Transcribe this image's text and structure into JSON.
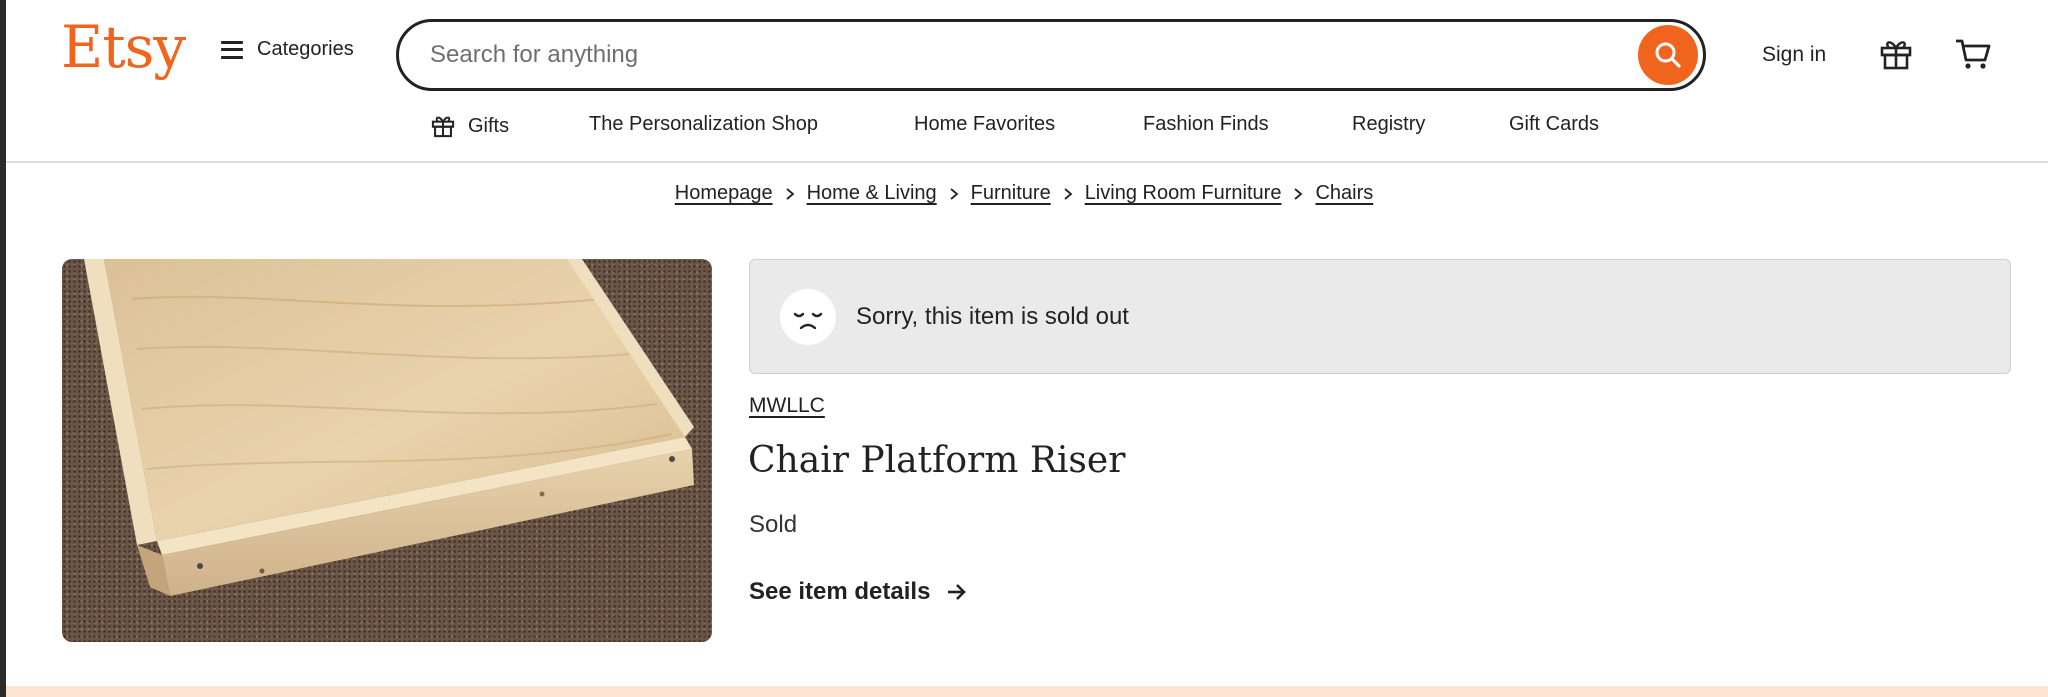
{
  "header": {
    "logo": "Etsy",
    "categories_label": "Categories",
    "search_placeholder": "Search for anything",
    "signin_label": "Sign in"
  },
  "nav": {
    "items": [
      {
        "label": "Gifts",
        "icon": "gift-icon"
      },
      {
        "label": "The Personalization Shop"
      },
      {
        "label": "Home Favorites"
      },
      {
        "label": "Fashion Finds"
      },
      {
        "label": "Registry"
      },
      {
        "label": "Gift Cards"
      }
    ]
  },
  "breadcrumb": [
    "Homepage",
    "Home & Living",
    "Furniture",
    "Living Room Furniture",
    "Chairs"
  ],
  "listing": {
    "sold_out_message": "Sorry, this item is sold out",
    "shop_name": "MWLLC",
    "title": "Chair Platform Riser",
    "status": "Sold",
    "details_link": "See item details"
  },
  "colors": {
    "brand": "#f1641e",
    "text": "#222222",
    "banner_bg": "#eaeaea",
    "bottom_strip": "#fde4d1"
  },
  "icons": [
    "hamburger-icon",
    "search-icon",
    "gift-icon",
    "cart-icon",
    "chevron-right-icon",
    "sad-face-icon",
    "arrow-right-icon"
  ]
}
